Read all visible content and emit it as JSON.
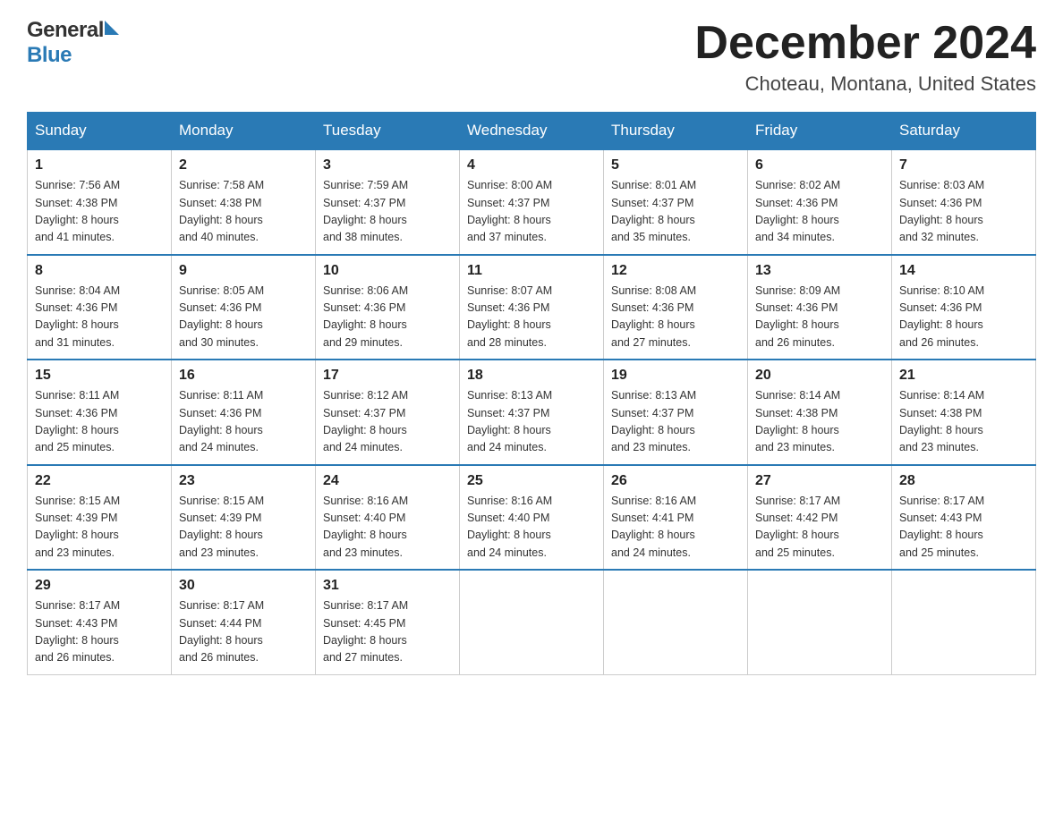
{
  "header": {
    "logo_general": "General",
    "logo_blue": "Blue",
    "month_title": "December 2024",
    "location": "Choteau, Montana, United States"
  },
  "days_of_week": [
    "Sunday",
    "Monday",
    "Tuesday",
    "Wednesday",
    "Thursday",
    "Friday",
    "Saturday"
  ],
  "weeks": [
    [
      {
        "day": "1",
        "sunrise": "7:56 AM",
        "sunset": "4:38 PM",
        "daylight": "8 hours and 41 minutes."
      },
      {
        "day": "2",
        "sunrise": "7:58 AM",
        "sunset": "4:38 PM",
        "daylight": "8 hours and 40 minutes."
      },
      {
        "day": "3",
        "sunrise": "7:59 AM",
        "sunset": "4:37 PM",
        "daylight": "8 hours and 38 minutes."
      },
      {
        "day": "4",
        "sunrise": "8:00 AM",
        "sunset": "4:37 PM",
        "daylight": "8 hours and 37 minutes."
      },
      {
        "day": "5",
        "sunrise": "8:01 AM",
        "sunset": "4:37 PM",
        "daylight": "8 hours and 35 minutes."
      },
      {
        "day": "6",
        "sunrise": "8:02 AM",
        "sunset": "4:36 PM",
        "daylight": "8 hours and 34 minutes."
      },
      {
        "day": "7",
        "sunrise": "8:03 AM",
        "sunset": "4:36 PM",
        "daylight": "8 hours and 32 minutes."
      }
    ],
    [
      {
        "day": "8",
        "sunrise": "8:04 AM",
        "sunset": "4:36 PM",
        "daylight": "8 hours and 31 minutes."
      },
      {
        "day": "9",
        "sunrise": "8:05 AM",
        "sunset": "4:36 PM",
        "daylight": "8 hours and 30 minutes."
      },
      {
        "day": "10",
        "sunrise": "8:06 AM",
        "sunset": "4:36 PM",
        "daylight": "8 hours and 29 minutes."
      },
      {
        "day": "11",
        "sunrise": "8:07 AM",
        "sunset": "4:36 PM",
        "daylight": "8 hours and 28 minutes."
      },
      {
        "day": "12",
        "sunrise": "8:08 AM",
        "sunset": "4:36 PM",
        "daylight": "8 hours and 27 minutes."
      },
      {
        "day": "13",
        "sunrise": "8:09 AM",
        "sunset": "4:36 PM",
        "daylight": "8 hours and 26 minutes."
      },
      {
        "day": "14",
        "sunrise": "8:10 AM",
        "sunset": "4:36 PM",
        "daylight": "8 hours and 26 minutes."
      }
    ],
    [
      {
        "day": "15",
        "sunrise": "8:11 AM",
        "sunset": "4:36 PM",
        "daylight": "8 hours and 25 minutes."
      },
      {
        "day": "16",
        "sunrise": "8:11 AM",
        "sunset": "4:36 PM",
        "daylight": "8 hours and 24 minutes."
      },
      {
        "day": "17",
        "sunrise": "8:12 AM",
        "sunset": "4:37 PM",
        "daylight": "8 hours and 24 minutes."
      },
      {
        "day": "18",
        "sunrise": "8:13 AM",
        "sunset": "4:37 PM",
        "daylight": "8 hours and 24 minutes."
      },
      {
        "day": "19",
        "sunrise": "8:13 AM",
        "sunset": "4:37 PM",
        "daylight": "8 hours and 23 minutes."
      },
      {
        "day": "20",
        "sunrise": "8:14 AM",
        "sunset": "4:38 PM",
        "daylight": "8 hours and 23 minutes."
      },
      {
        "day": "21",
        "sunrise": "8:14 AM",
        "sunset": "4:38 PM",
        "daylight": "8 hours and 23 minutes."
      }
    ],
    [
      {
        "day": "22",
        "sunrise": "8:15 AM",
        "sunset": "4:39 PM",
        "daylight": "8 hours and 23 minutes."
      },
      {
        "day": "23",
        "sunrise": "8:15 AM",
        "sunset": "4:39 PM",
        "daylight": "8 hours and 23 minutes."
      },
      {
        "day": "24",
        "sunrise": "8:16 AM",
        "sunset": "4:40 PM",
        "daylight": "8 hours and 23 minutes."
      },
      {
        "day": "25",
        "sunrise": "8:16 AM",
        "sunset": "4:40 PM",
        "daylight": "8 hours and 24 minutes."
      },
      {
        "day": "26",
        "sunrise": "8:16 AM",
        "sunset": "4:41 PM",
        "daylight": "8 hours and 24 minutes."
      },
      {
        "day": "27",
        "sunrise": "8:17 AM",
        "sunset": "4:42 PM",
        "daylight": "8 hours and 25 minutes."
      },
      {
        "day": "28",
        "sunrise": "8:17 AM",
        "sunset": "4:43 PM",
        "daylight": "8 hours and 25 minutes."
      }
    ],
    [
      {
        "day": "29",
        "sunrise": "8:17 AM",
        "sunset": "4:43 PM",
        "daylight": "8 hours and 26 minutes."
      },
      {
        "day": "30",
        "sunrise": "8:17 AM",
        "sunset": "4:44 PM",
        "daylight": "8 hours and 26 minutes."
      },
      {
        "day": "31",
        "sunrise": "8:17 AM",
        "sunset": "4:45 PM",
        "daylight": "8 hours and 27 minutes."
      },
      null,
      null,
      null,
      null
    ]
  ],
  "labels": {
    "sunrise": "Sunrise:",
    "sunset": "Sunset:",
    "daylight": "Daylight:"
  }
}
